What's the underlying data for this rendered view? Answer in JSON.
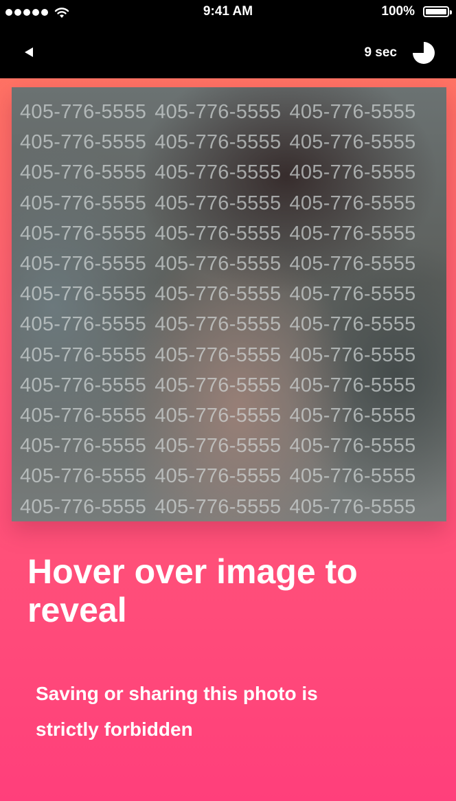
{
  "status_bar": {
    "time": "9:41 AM",
    "battery_percent": "100%",
    "signal_icon": "signal-dots-icon",
    "wifi_icon": "wifi-icon",
    "battery_icon": "battery-icon"
  },
  "nav": {
    "back_icon": "back-arrow-icon",
    "timer_label": "9 sec",
    "timer_icon": "countdown-pie-icon"
  },
  "photo": {
    "watermark_text": "405-776-5555",
    "state": "blurred"
  },
  "headline": "Hover over image to reveal",
  "subtext": "Saving or sharing this photo is strictly forbidden",
  "colors": {
    "gradient_top": "#ff7264",
    "gradient_bottom": "#ff3f7b",
    "bar_background": "#000000",
    "text": "#ffffff"
  }
}
